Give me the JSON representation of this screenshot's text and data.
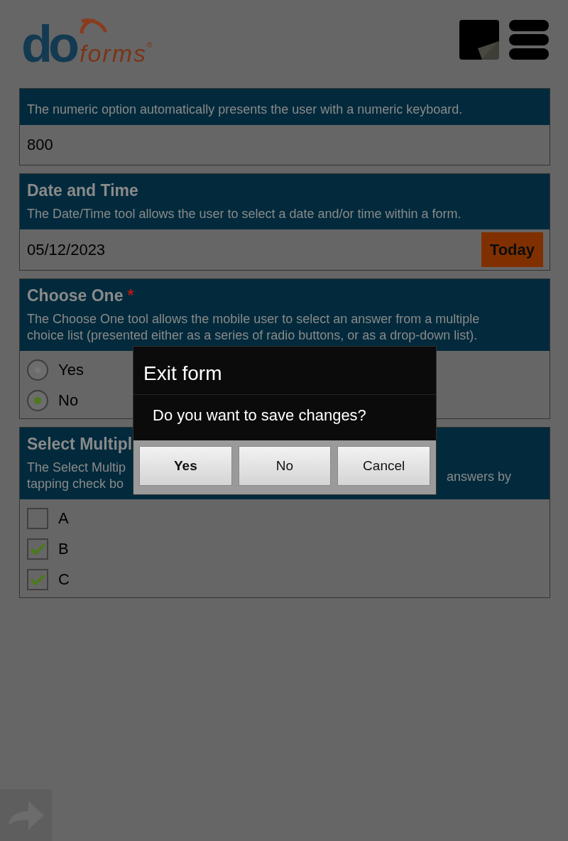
{
  "header": {
    "logo": {
      "part_1": "do",
      "part_2": "forms",
      "mark": "®"
    }
  },
  "fields": [
    {
      "kind": "number",
      "description": "The numeric option automatically presents the user with a numeric keyboard.",
      "value": "800"
    },
    {
      "kind": "date",
      "title": "Date and Time",
      "description": "The Date/Time tool allows the user to select a date and/or time within a form.",
      "value": "05/12/2023",
      "button": "Today"
    },
    {
      "kind": "choose_one",
      "title": "Choose One",
      "required_mark": "*",
      "description": "The Choose One tool allows the mobile user to select an answer from a multiple choice list (presented either as a series of radio buttons, or as a drop-down list).",
      "options": [
        {
          "label": "Yes",
          "selected": false
        },
        {
          "label": "No",
          "selected": true
        }
      ]
    },
    {
      "kind": "select_multiple",
      "title": "Select Multipl",
      "description_left": [
        "The Select Multip",
        "tapping check bo"
      ],
      "description_right": "answers by",
      "options": [
        {
          "label": "A",
          "checked": false
        },
        {
          "label": "B",
          "checked": true
        },
        {
          "label": "C",
          "checked": true
        }
      ]
    }
  ],
  "dialog": {
    "title": "Exit form",
    "message": "Do you want to save changes?",
    "buttons": [
      {
        "label": "Yes",
        "default": true
      },
      {
        "label": "No",
        "default": false
      },
      {
        "label": "Cancel",
        "default": false
      }
    ]
  }
}
